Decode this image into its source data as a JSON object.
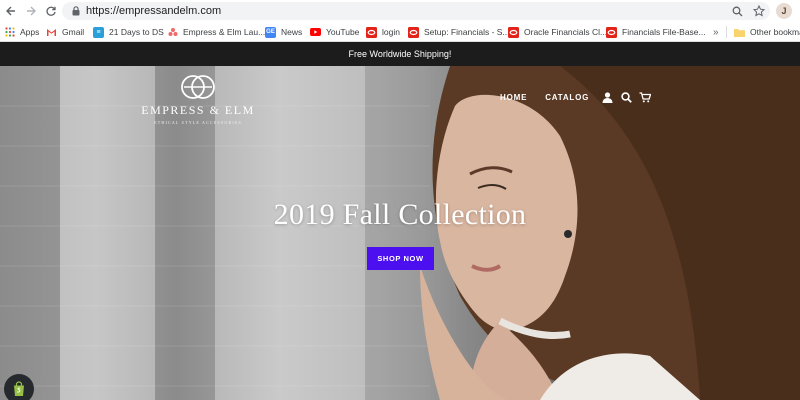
{
  "browser": {
    "url": "https://empressandelm.com",
    "avatar_initial": "J",
    "more_bookmarks": "»",
    "bookmarks": [
      {
        "label": "Apps",
        "icon": "apps-grid-icon"
      },
      {
        "label": "Gmail",
        "icon": "gmail-icon"
      },
      {
        "label": "21 Days to DS",
        "icon": "bookmark-site-icon"
      },
      {
        "label": "Empress & Elm Lau...",
        "icon": "asana-icon"
      },
      {
        "label": "News",
        "icon": "google-news-icon"
      },
      {
        "label": "YouTube",
        "icon": "youtube-icon"
      },
      {
        "label": "login",
        "icon": "oracle-icon"
      },
      {
        "label": "Setup: Financials - S...",
        "icon": "oracle-icon"
      },
      {
        "label": "Oracle Financials Cl...",
        "icon": "oracle-icon"
      },
      {
        "label": "Financials File-Base...",
        "icon": "oracle-icon"
      },
      {
        "label": "Other bookma",
        "icon": "folder-icon"
      }
    ]
  },
  "announcement": "Free Worldwide Shipping!",
  "site": {
    "logo_name": "EMPRESS & ELM",
    "logo_tagline": "ETHICAL STYLE ACCESSORIES",
    "nav": {
      "home": "HOME",
      "catalog": "CATALOG"
    }
  },
  "hero": {
    "title": "2019 Fall Collection",
    "button": "SHOP NOW"
  },
  "colors": {
    "accent_button": "#4b0ff0",
    "announcement_bg": "#1c1c1c"
  }
}
